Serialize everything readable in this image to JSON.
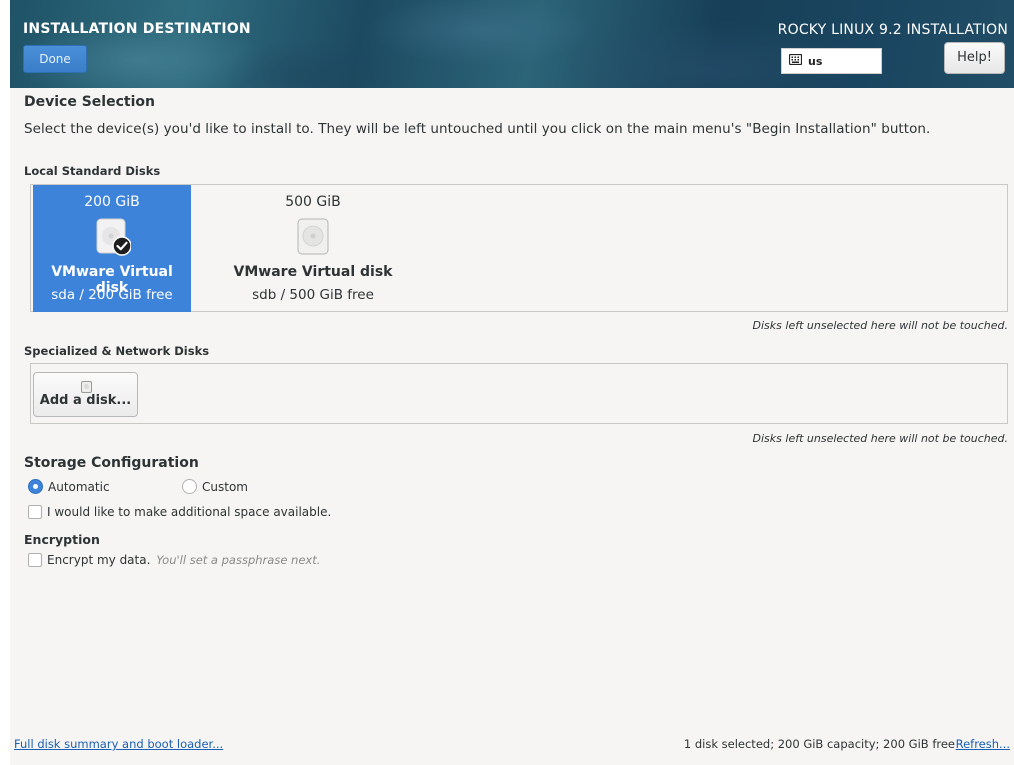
{
  "header": {
    "title": "INSTALLATION DESTINATION",
    "done_label": "Done",
    "product_title": "ROCKY LINUX 9.2 INSTALLATION",
    "keyboard_layout": "us",
    "keyboard_icon": "keyboard-icon",
    "help_label": "Help!"
  },
  "device_selection": {
    "heading": "Device Selection",
    "description": "Select the device(s) you'd like to install to.  They will be left untouched until you click on the main menu's \"Begin Installation\" button."
  },
  "local_disks": {
    "label": "Local Standard Disks",
    "disks": [
      {
        "size": "200 GiB",
        "name": "VMware Virtual disk",
        "free": "sda  /  200 GiB free",
        "selected": true,
        "icon": "hard-drive-icon"
      },
      {
        "size": "500 GiB",
        "name": "VMware Virtual disk",
        "free": "sdb  /  500 GiB free",
        "selected": false,
        "icon": "hard-drive-icon"
      }
    ],
    "note": "Disks left unselected here will not be touched."
  },
  "specialized_disks": {
    "label": "Specialized & Network Disks",
    "add_button_label": "Add a disk...",
    "add_button_icon": "disk-icon",
    "note": "Disks left unselected here will not be touched."
  },
  "storage_configuration": {
    "heading": "Storage Configuration",
    "options": [
      {
        "label": "Automatic",
        "checked": true
      },
      {
        "label": "Custom",
        "checked": false
      }
    ],
    "additional_space_label": "I would like to make additional space available.",
    "additional_space_checked": false
  },
  "encryption": {
    "heading": "Encryption",
    "encrypt_label": "Encrypt my data.",
    "encrypt_hint": "You'll set a passphrase next.",
    "encrypt_checked": false
  },
  "footer": {
    "summary_link": "Full disk summary and boot loader...",
    "status": "1 disk selected; 200 GiB capacity; 200 GiB free",
    "refresh_link": "Refresh..."
  },
  "colors": {
    "accent": "#3d83d9",
    "link": "#1a5fb4",
    "background": "#f6f5f4"
  }
}
